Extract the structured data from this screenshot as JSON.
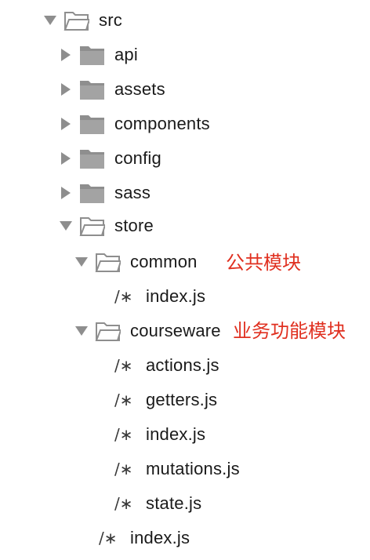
{
  "tree": {
    "src": "src",
    "api": "api",
    "assets": "assets",
    "components": "components",
    "config": "config",
    "sass": "sass",
    "store": "store",
    "common": "common",
    "common_annotation": "公共模块",
    "common_index": "index.js",
    "courseware": "courseware",
    "courseware_annotation": "业务功能模块",
    "actions": "actions.js",
    "getters": "getters.js",
    "courseware_index": "index.js",
    "mutations": "mutations.js",
    "state": "state.js",
    "store_index": "index.js",
    "js_icon": "/∗"
  },
  "icons": {
    "folder_closed": "folder-icon",
    "folder_open": "folder-open-icon",
    "js_file": "js-file-icon"
  },
  "colors": {
    "annotation": "#e03020",
    "folder": "#8e8e8e",
    "arrow": "#8e8e8e"
  }
}
